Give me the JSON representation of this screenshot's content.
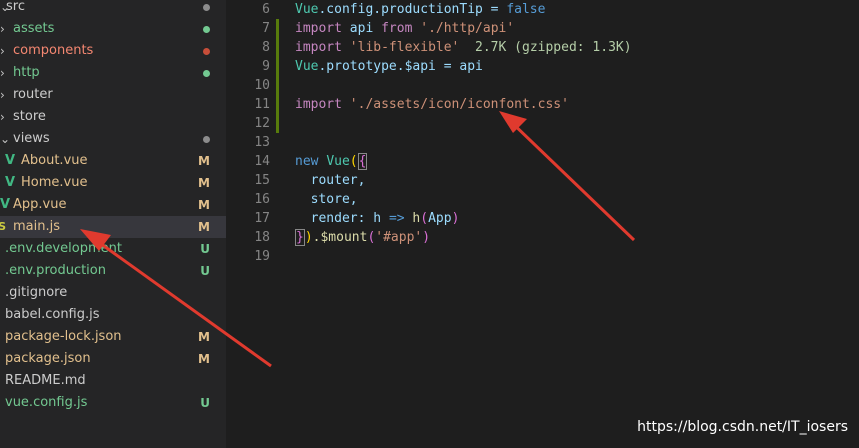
{
  "colors": {
    "folder_text": "#cccccc",
    "modified_text": "#e2c08d",
    "untracked_text": "#73c991",
    "error_text": "#f48771",
    "dot_green": "#73c991",
    "dot_red": "#c74e39",
    "dot_gray": "#8c8c8c",
    "badge_m": "#e2c08d",
    "badge_u": "#73c991",
    "vue_icon": "#41b883",
    "js_icon": "#cbcb41",
    "gutter_mod": "#1b81a8",
    "gutter_add": "#587c0c",
    "arrow": "#e03a2e"
  },
  "explorer": {
    "items": [
      {
        "name": "src",
        "indent": 0,
        "kind": "folder-open",
        "status": "dot-gray",
        "color": "folder",
        "partial": true
      },
      {
        "name": "assets",
        "indent": 1,
        "kind": "folder-closed",
        "status": "dot-green",
        "color": "untracked"
      },
      {
        "name": "components",
        "indent": 1,
        "kind": "folder-closed",
        "status": "dot-red",
        "color": "error"
      },
      {
        "name": "http",
        "indent": 1,
        "kind": "folder-closed",
        "status": "dot-green",
        "color": "untracked"
      },
      {
        "name": "router",
        "indent": 1,
        "kind": "folder-closed",
        "status": "",
        "color": "folder"
      },
      {
        "name": "store",
        "indent": 1,
        "kind": "folder-closed",
        "status": "",
        "color": "folder"
      },
      {
        "name": "views",
        "indent": 1,
        "kind": "folder-open",
        "status": "dot-gray",
        "color": "folder"
      },
      {
        "name": "About.vue",
        "indent": 2,
        "kind": "vue",
        "status": "M",
        "color": "modified"
      },
      {
        "name": "Home.vue",
        "indent": 2,
        "kind": "vue",
        "status": "M",
        "color": "modified"
      },
      {
        "name": "App.vue",
        "indent": 1,
        "kind": "vue",
        "status": "M",
        "color": "modified"
      },
      {
        "name": "main.js",
        "indent": 1,
        "kind": "js",
        "status": "M",
        "color": "modified",
        "selected": true
      },
      {
        "name": ".env.development",
        "indent": 0,
        "kind": "file",
        "status": "U",
        "color": "untracked"
      },
      {
        "name": ".env.production",
        "indent": 0,
        "kind": "file",
        "status": "U",
        "color": "untracked"
      },
      {
        "name": ".gitignore",
        "indent": 0,
        "kind": "file",
        "status": "",
        "color": "folder"
      },
      {
        "name": "babel.config.js",
        "indent": 0,
        "kind": "file",
        "status": "",
        "color": "folder"
      },
      {
        "name": "package-lock.json",
        "indent": 0,
        "kind": "file",
        "status": "M",
        "color": "modified"
      },
      {
        "name": "package.json",
        "indent": 0,
        "kind": "file",
        "status": "M",
        "color": "modified"
      },
      {
        "name": "README.md",
        "indent": 0,
        "kind": "file",
        "status": "",
        "color": "folder"
      },
      {
        "name": "vue.config.js",
        "indent": 0,
        "kind": "file",
        "status": "U",
        "color": "untracked"
      }
    ],
    "vue_glyph": "V",
    "js_glyph": "JS"
  },
  "editor": {
    "lines": [
      {
        "num": "6",
        "gutter": "",
        "tokens": [
          {
            "t": "Vue",
            "c": "#4ec9b0"
          },
          {
            "t": ".config.productionTip = ",
            "c": "#9cdcfe"
          },
          {
            "t": "false",
            "c": "#569cd6"
          }
        ]
      },
      {
        "num": "7",
        "gutter": "add",
        "tokens": [
          {
            "t": "import ",
            "c": "#c586c0"
          },
          {
            "t": "api ",
            "c": "#9cdcfe"
          },
          {
            "t": "from ",
            "c": "#c586c0"
          },
          {
            "t": "'./http/api'",
            "c": "#ce9178"
          }
        ]
      },
      {
        "num": "8",
        "gutter": "add",
        "tokens": [
          {
            "t": "import ",
            "c": "#c586c0"
          },
          {
            "t": "'lib-flexible'",
            "c": "#ce9178"
          },
          {
            "t": "  2.7K (gzipped: 1.3K)",
            "c": "#b5cea8"
          }
        ]
      },
      {
        "num": "9",
        "gutter": "add",
        "tokens": [
          {
            "t": "Vue",
            "c": "#4ec9b0"
          },
          {
            "t": ".prototype.$api = api",
            "c": "#9cdcfe"
          }
        ]
      },
      {
        "num": "10",
        "gutter": "add",
        "tokens": []
      },
      {
        "num": "11",
        "gutter": "add",
        "tokens": [
          {
            "t": "import ",
            "c": "#c586c0"
          },
          {
            "t": "'./assets/icon/iconfont.css'",
            "c": "#ce9178"
          }
        ]
      },
      {
        "num": "12",
        "gutter": "add",
        "tokens": []
      },
      {
        "num": "13",
        "gutter": "",
        "tokens": []
      },
      {
        "num": "14",
        "gutter": "",
        "tokens": [
          {
            "t": "new ",
            "c": "#569cd6"
          },
          {
            "t": "Vue",
            "c": "#4ec9b0"
          },
          {
            "t": "(",
            "c": "#ffd700"
          },
          {
            "t": "{",
            "c": "#da70d6",
            "box": true
          }
        ]
      },
      {
        "num": "15",
        "gutter": "",
        "tokens": [
          {
            "t": "  router,",
            "c": "#9cdcfe"
          }
        ]
      },
      {
        "num": "16",
        "gutter": "",
        "tokens": [
          {
            "t": "  store,",
            "c": "#9cdcfe"
          }
        ]
      },
      {
        "num": "17",
        "gutter": "",
        "tokens": [
          {
            "t": "  render: ",
            "c": "#9cdcfe"
          },
          {
            "t": "h ",
            "c": "#9cdcfe"
          },
          {
            "t": "=> ",
            "c": "#569cd6"
          },
          {
            "t": "h",
            "c": "#dcdcaa"
          },
          {
            "t": "(",
            "c": "#da70d6"
          },
          {
            "t": "App",
            "c": "#9cdcfe"
          },
          {
            "t": ")",
            "c": "#da70d6"
          }
        ]
      },
      {
        "num": "18",
        "gutter": "",
        "tokens": [
          {
            "t": "}",
            "c": "#da70d6",
            "box": true
          },
          {
            "t": ")",
            "c": "#ffd700"
          },
          {
            "t": ".$mount",
            "c": "#dcdcaa"
          },
          {
            "t": "(",
            "c": "#da70d6"
          },
          {
            "t": "'#app'",
            "c": "#ce9178"
          },
          {
            "t": ")",
            "c": "#da70d6"
          }
        ]
      },
      {
        "num": "19",
        "gutter": "",
        "tokens": []
      }
    ]
  },
  "watermark": "https://blog.csdn.net/IT_iosers"
}
